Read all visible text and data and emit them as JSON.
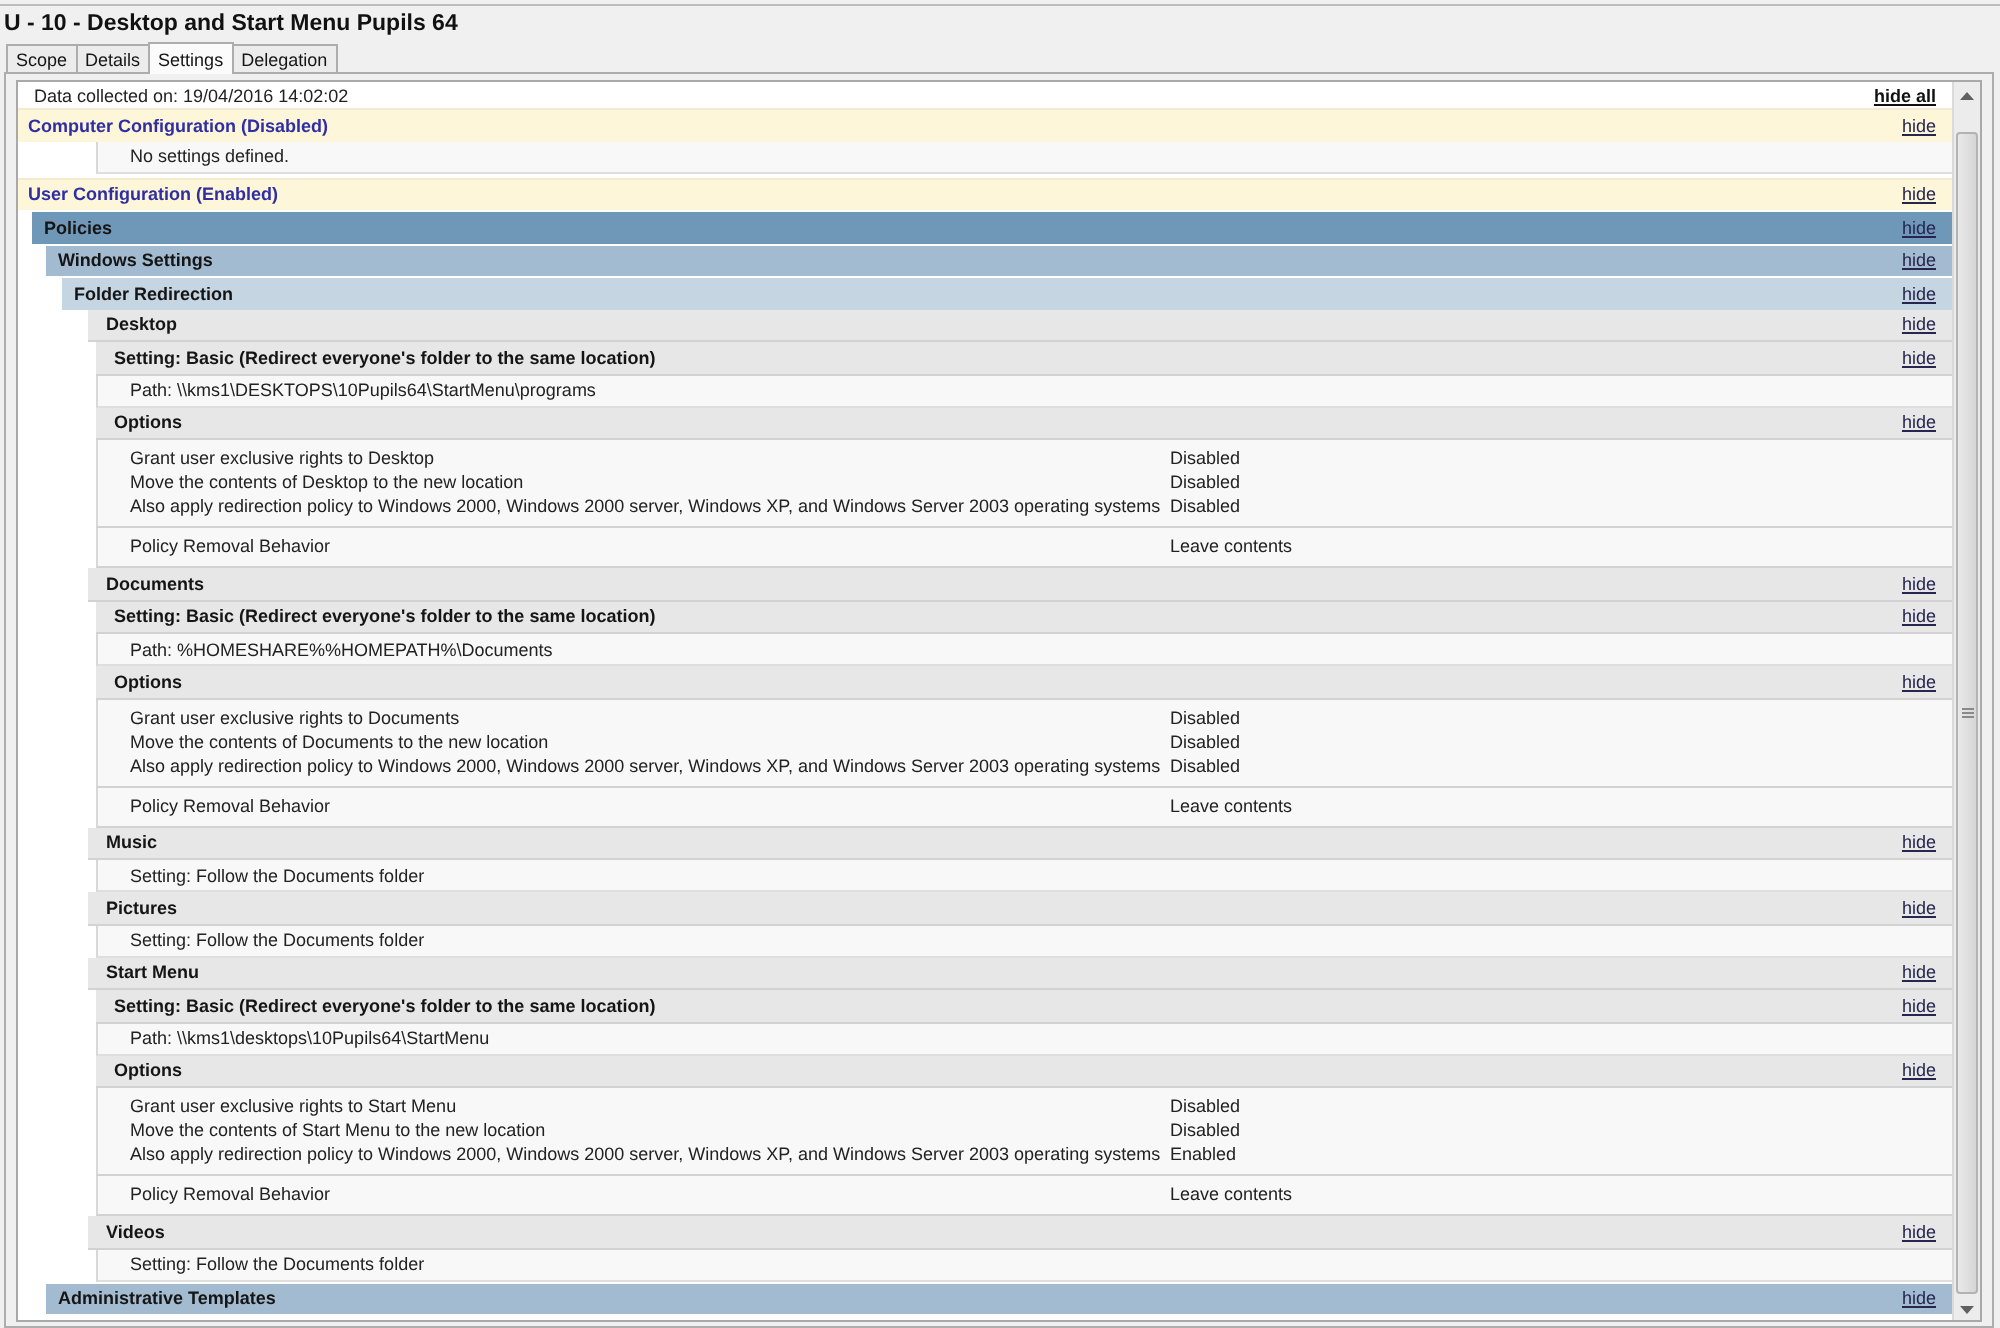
{
  "window": {
    "title": "U - 10 - Desktop and Start Menu Pupils 64"
  },
  "tabs": [
    {
      "label": "Scope",
      "selected": false
    },
    {
      "label": "Details",
      "selected": false
    },
    {
      "label": "Settings",
      "selected": true
    },
    {
      "label": "Delegation",
      "selected": false
    }
  ],
  "report": {
    "collected": "Data collected on: 19/04/2016 14:02:02",
    "hide_all": "hide all",
    "nodes": [
      {
        "kind": "config",
        "label": "Computer Configuration (Disabled)",
        "action": "hide",
        "children": [
          {
            "kind": "note",
            "text": "No settings defined."
          }
        ]
      },
      {
        "kind": "config",
        "label": "User Configuration (Enabled)",
        "action": "hide",
        "children": [
          {
            "kind": "category",
            "label": "Policies",
            "action": "hide",
            "children": [
              {
                "kind": "category",
                "label": "Windows Settings",
                "action": "hide",
                "children": [
                  {
                    "kind": "category",
                    "label": "Folder Redirection",
                    "action": "hide",
                    "children": [
                      {
                        "kind": "folder",
                        "label": "Desktop",
                        "action": "hide",
                        "children": [
                          {
                            "kind": "heading",
                            "label": "Setting: Basic (Redirect everyone's folder to the same location)",
                            "action": "hide"
                          },
                          {
                            "kind": "note",
                            "text": "Path: \\\\kms1\\DESKTOPS\\10Pupils64\\StartMenu\\programs"
                          },
                          {
                            "kind": "heading",
                            "label": "Options",
                            "action": "hide"
                          },
                          {
                            "kind": "options",
                            "rows": [
                              {
                                "name": "Grant user exclusive rights to Desktop",
                                "value": "Disabled"
                              },
                              {
                                "name": "Move the contents of Desktop to the new location",
                                "value": "Disabled"
                              },
                              {
                                "name": "Also apply redirection policy to Windows 2000, Windows 2000 server, Windows XP, and Windows Server 2003 operating systems",
                                "value": "Disabled"
                              }
                            ]
                          },
                          {
                            "kind": "options",
                            "rows": [
                              {
                                "name": "Policy Removal Behavior",
                                "value": "Leave contents"
                              }
                            ]
                          }
                        ]
                      },
                      {
                        "kind": "folder",
                        "label": "Documents",
                        "action": "hide",
                        "children": [
                          {
                            "kind": "heading",
                            "label": "Setting: Basic (Redirect everyone's folder to the same location)",
                            "action": "hide"
                          },
                          {
                            "kind": "note",
                            "text": "Path: %HOMESHARE%%HOMEPATH%\\Documents"
                          },
                          {
                            "kind": "heading",
                            "label": "Options",
                            "action": "hide"
                          },
                          {
                            "kind": "options",
                            "rows": [
                              {
                                "name": "Grant user exclusive rights to Documents",
                                "value": "Disabled"
                              },
                              {
                                "name": "Move the contents of Documents to the new location",
                                "value": "Disabled"
                              },
                              {
                                "name": "Also apply redirection policy to Windows 2000, Windows 2000 server, Windows XP, and Windows Server 2003 operating systems",
                                "value": "Disabled"
                              }
                            ]
                          },
                          {
                            "kind": "options",
                            "rows": [
                              {
                                "name": "Policy Removal Behavior",
                                "value": "Leave contents"
                              }
                            ]
                          }
                        ]
                      },
                      {
                        "kind": "folder",
                        "label": "Music",
                        "action": "hide",
                        "children": [
                          {
                            "kind": "note",
                            "text": "Setting: Follow the Documents folder"
                          }
                        ]
                      },
                      {
                        "kind": "folder",
                        "label": "Pictures",
                        "action": "hide",
                        "children": [
                          {
                            "kind": "note",
                            "text": "Setting: Follow the Documents folder"
                          }
                        ]
                      },
                      {
                        "kind": "folder",
                        "label": "Start Menu",
                        "action": "hide",
                        "children": [
                          {
                            "kind": "heading",
                            "label": "Setting: Basic (Redirect everyone's folder to the same location)",
                            "action": "hide"
                          },
                          {
                            "kind": "note",
                            "text": "Path: \\\\kms1\\desktops\\10Pupils64\\StartMenu"
                          },
                          {
                            "kind": "heading",
                            "label": "Options",
                            "action": "hide"
                          },
                          {
                            "kind": "options",
                            "rows": [
                              {
                                "name": "Grant user exclusive rights to Start Menu",
                                "value": "Disabled"
                              },
                              {
                                "name": "Move the contents of Start Menu to the new location",
                                "value": "Disabled"
                              },
                              {
                                "name": "Also apply redirection policy to Windows 2000, Windows 2000 server, Windows XP, and Windows Server 2003 operating systems",
                                "value": "Enabled"
                              }
                            ]
                          },
                          {
                            "kind": "options",
                            "rows": [
                              {
                                "name": "Policy Removal Behavior",
                                "value": "Leave contents"
                              }
                            ]
                          }
                        ]
                      },
                      {
                        "kind": "folder",
                        "label": "Videos",
                        "action": "hide",
                        "children": [
                          {
                            "kind": "note",
                            "text": "Setting: Follow the Documents folder"
                          }
                        ]
                      }
                    ]
                  }
                ]
              },
              {
                "kind": "category",
                "label": "Administrative Templates",
                "action": "hide"
              }
            ]
          }
        ]
      }
    ]
  }
}
